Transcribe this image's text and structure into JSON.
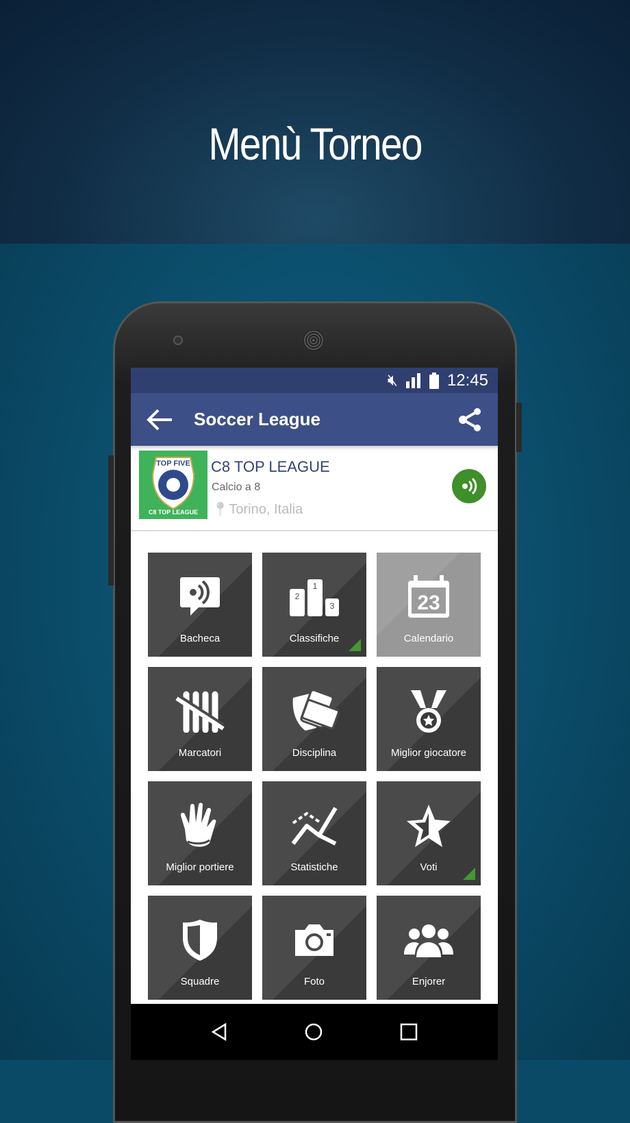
{
  "headline": "Menù Torneo",
  "status": {
    "time": "12:45",
    "icons": [
      "mute-icon",
      "signal-icon",
      "battery-icon"
    ]
  },
  "appbar": {
    "title": "Soccer League",
    "back_icon": "arrow-left-icon",
    "share_icon": "share-icon"
  },
  "league": {
    "name": "C8 TOP LEAGUE",
    "sport": "Calcio a 8",
    "location": "Torino, Italia",
    "logo_text": "TOP FIVE 1997 C8 TOP LEAGUE",
    "feed_color": "#3f8f2a"
  },
  "tiles": [
    {
      "label": "Bacheca",
      "icon": "chat-feed-icon"
    },
    {
      "label": "Classifiche",
      "icon": "podium-icon",
      "badge": true
    },
    {
      "label": "Calendario",
      "icon": "calendar-icon",
      "calendar_day": "23",
      "disabled": true
    },
    {
      "label": "Marcatori",
      "icon": "tally-icon"
    },
    {
      "label": "Disciplina",
      "icon": "cards-icon"
    },
    {
      "label": "Miglior giocatore",
      "icon": "medal-icon"
    },
    {
      "label": "Miglior portiere",
      "icon": "glove-icon"
    },
    {
      "label": "Statistiche",
      "icon": "chart-icon"
    },
    {
      "label": "Voti",
      "icon": "star-icon",
      "badge": true
    },
    {
      "label": "Squadre",
      "icon": "shield-icon"
    },
    {
      "label": "Foto",
      "icon": "camera-icon"
    },
    {
      "label": "Enjorer",
      "icon": "group-icon"
    }
  ],
  "podium": {
    "first": "1",
    "second": "2",
    "third": "3"
  },
  "accent": "#3d4f87"
}
